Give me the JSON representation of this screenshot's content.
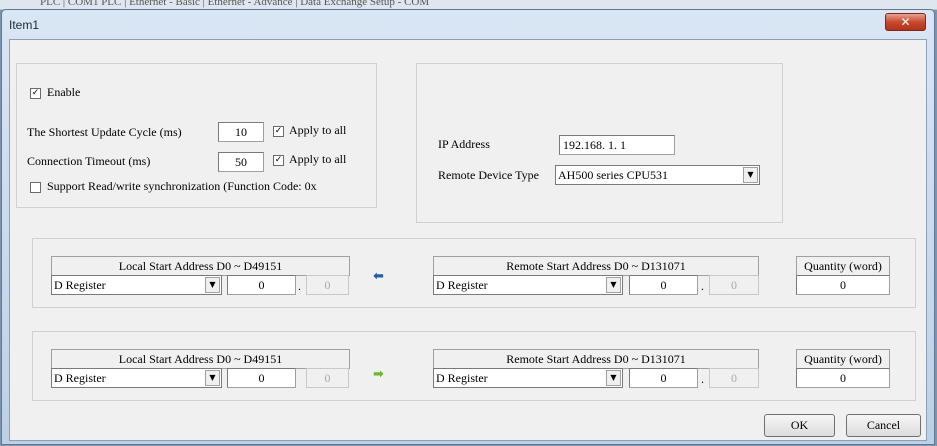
{
  "background_strip": "PLC | COM1 PLC | Ethernet - Basic | Ethernet - Advance | Data Exchange Setup - COM",
  "window": {
    "title": "Item1",
    "close_glyph": "✕"
  },
  "settings": {
    "enable": {
      "label": "Enable",
      "checked": true,
      "mark": "✓"
    },
    "update_cycle": {
      "label": "The Shortest Update Cycle (ms)",
      "value": "10",
      "apply_label": "Apply to all",
      "apply_mark": "✓"
    },
    "timeout": {
      "label": "Connection Timeout (ms)",
      "value": "50",
      "apply_label": "Apply to all",
      "apply_mark": "✓"
    },
    "sync": {
      "label": "Support Read/write synchronization (Function Code: 0x",
      "checked": false
    }
  },
  "remote": {
    "ip_label": "IP Address",
    "ip_value": "192.168.  1.  1",
    "device_type_label": "Remote Device Type",
    "device_type_value": "AH500 series CPU531"
  },
  "mappings": [
    {
      "local_header": "Local Start Address D0 ~ D49151",
      "local_type": "D Register",
      "local_addr": "0",
      "local_bit": "0",
      "direction": "read",
      "arrow_glyph": "⬅",
      "arrow_color": "#1f5fa8",
      "remote_header": "Remote Start Address D0 ~ D131071",
      "remote_type": "D Register",
      "remote_addr": "0",
      "remote_bit": "0",
      "qty_header": "Quantity (word)",
      "qty": "0"
    },
    {
      "local_header": "Local Start Address D0 ~ D49151",
      "local_type": "D Register",
      "local_addr": "0",
      "local_bit": "0",
      "direction": "write",
      "arrow_glyph": "➡",
      "arrow_color": "#6ab82e",
      "remote_header": "Remote Start Address D0 ~ D131071",
      "remote_type": "D Register",
      "remote_addr": "0",
      "remote_bit": "0",
      "qty_header": "Quantity (word)",
      "qty": "0"
    }
  ],
  "buttons": {
    "ok": "OK",
    "cancel": "Cancel"
  },
  "icons": {
    "dropdown": "▼"
  }
}
